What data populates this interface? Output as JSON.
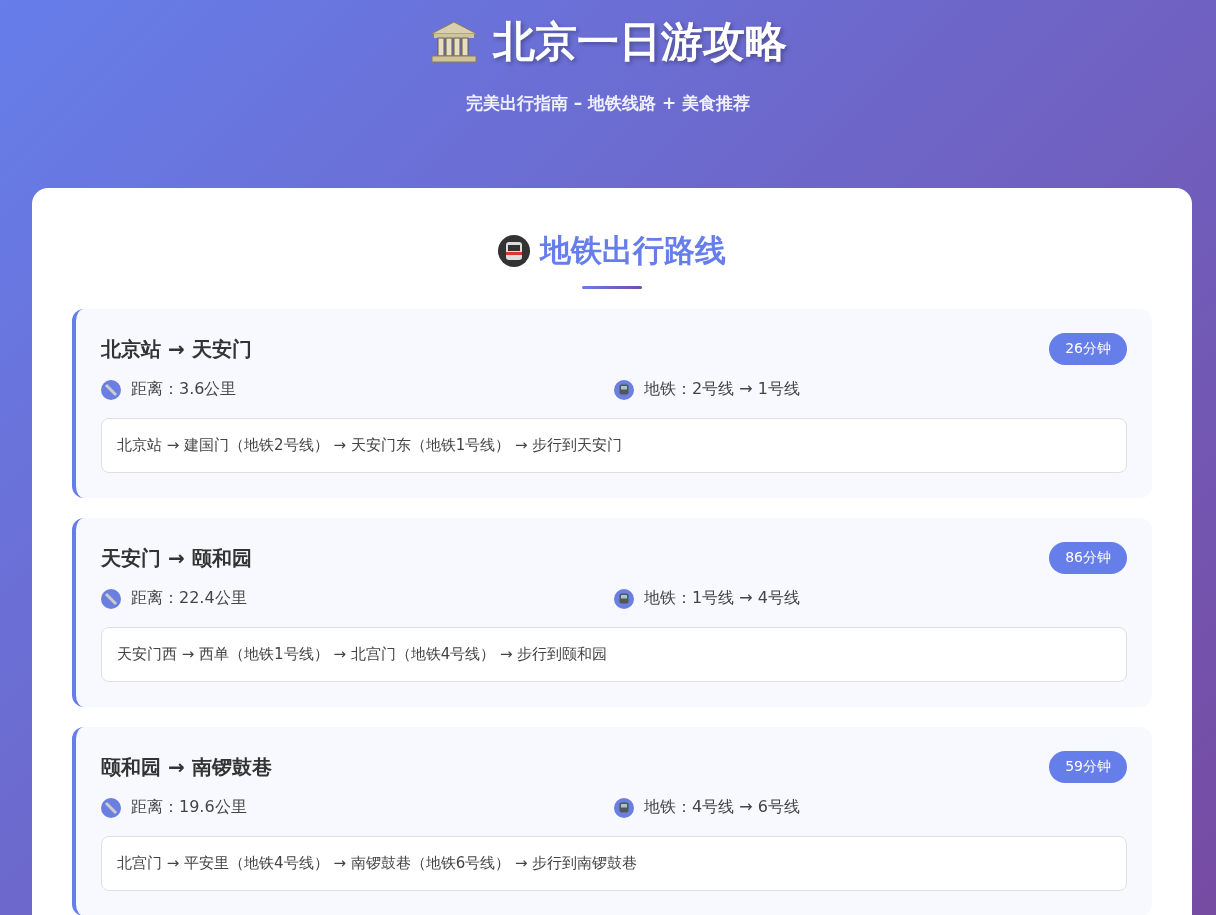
{
  "header": {
    "title": "北京一日游攻略",
    "subtitle": "完美出行指南 – 地铁线路 + 美食推荐"
  },
  "section": {
    "title": "地铁出行路线",
    "routes": [
      {
        "title": "北京站 → 天安门",
        "duration": "26分钟",
        "distance": "距离：3.6公里",
        "subway": "地铁：2号线 → 1号线",
        "path": "北京站 → 建国门（地铁2号线） → 天安门东（地铁1号线） → 步行到天安门"
      },
      {
        "title": "天安门 → 颐和园",
        "duration": "86分钟",
        "distance": "距离：22.4公里",
        "subway": "地铁：1号线 → 4号线",
        "path": "天安门西 → 西单（地铁1号线） → 北宫门（地铁4号线） → 步行到颐和园"
      },
      {
        "title": "颐和园 → 南锣鼓巷",
        "duration": "59分钟",
        "distance": "距离：19.6公里",
        "subway": "地铁：4号线 → 6号线",
        "path": "北宫门 → 平安里（地铁4号线） → 南锣鼓巷（地铁6号线） → 步行到南锣鼓巷"
      }
    ]
  }
}
